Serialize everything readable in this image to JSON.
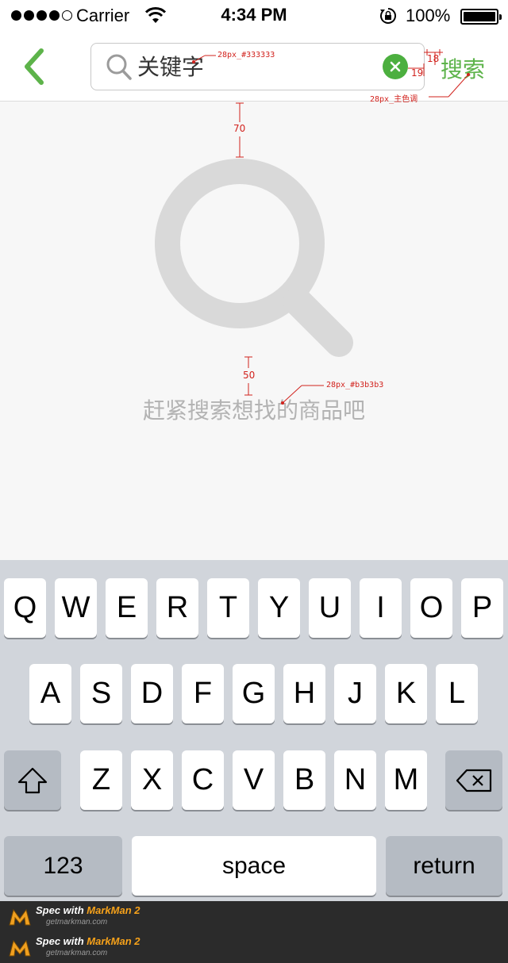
{
  "status_bar": {
    "carrier": "Carrier",
    "time": "4:34 PM",
    "battery": "100%"
  },
  "nav": {
    "search_placeholder": "关键字",
    "search_button": "搜索"
  },
  "empty_state": {
    "text": "赶紧搜索想找的商品吧"
  },
  "annotations": {
    "input_spec": "28px_#333333",
    "button_spec": "28px_主色调",
    "text_spec": "28px_#b3b3b3",
    "gap_top": "70",
    "gap_text": "50",
    "gap_btn_h": "18",
    "gap_btn_v": "19"
  },
  "keyboard": {
    "row1": [
      "Q",
      "W",
      "E",
      "R",
      "T",
      "Y",
      "U",
      "I",
      "O",
      "P"
    ],
    "row2": [
      "A",
      "S",
      "D",
      "F",
      "G",
      "H",
      "J",
      "K",
      "L"
    ],
    "row3": [
      "Z",
      "X",
      "C",
      "V",
      "B",
      "N",
      "M"
    ],
    "numbers_key": "123",
    "space_key": "space",
    "return_key": "return"
  },
  "footer": {
    "spec_prefix": "Spec with ",
    "brand": "MarkMan 2",
    "url": "getmarkman.com"
  },
  "colors": {
    "accent": "#5db34a",
    "clear": "#4caf3f",
    "empty_icon": "#d9d9d9",
    "empty_text": "#b3b3b3"
  }
}
